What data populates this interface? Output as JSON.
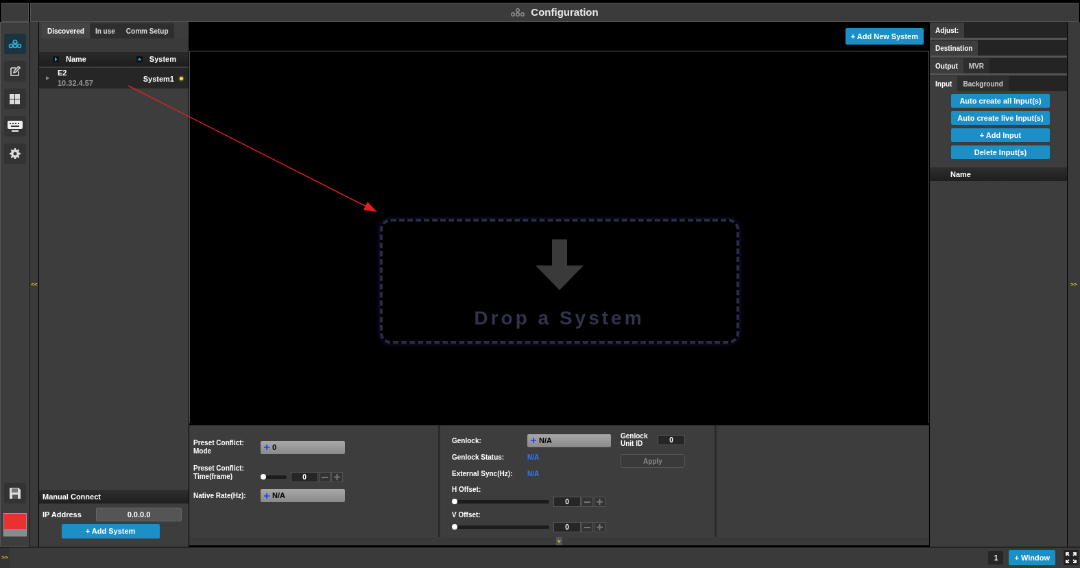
{
  "title_bar": {
    "title": "Configuration"
  },
  "nav_rail": {
    "items": [
      {
        "kind": "network",
        "selected": true
      },
      {
        "kind": "edit",
        "selected": false
      },
      {
        "kind": "grid",
        "selected": false
      },
      {
        "kind": "keyboard",
        "selected": false
      },
      {
        "kind": "settings",
        "selected": false
      }
    ],
    "save": true
  },
  "left_collapse": "<<",
  "left_panel": {
    "tabs": [
      {
        "label": "Discovered",
        "selected": true
      },
      {
        "label": "In use",
        "selected": false
      },
      {
        "label": "Comm Setup",
        "selected": false
      }
    ],
    "columns": [
      "Name",
      "System"
    ],
    "systems": [
      {
        "name": "E2",
        "address": "10.32.4.57",
        "system": "System1",
        "expanded": false,
        "color": "#e8e04a"
      }
    ],
    "manual_connect": {
      "title": "Manual Connect",
      "ip_label": "IP Address",
      "ip_value": "0.0.0.0",
      "button": "+ Add System"
    }
  },
  "canvas": {
    "add_button": "+ Add New System",
    "drop_text": "Drop a System"
  },
  "settings": {
    "left": [
      {
        "kind": "dropdown",
        "label": "Preset Conflict: Mode",
        "value": "0"
      },
      {
        "kind": "slider",
        "label": "Preset Conflict: Time(frame)",
        "value": "0",
        "level": 0
      },
      {
        "kind": "dropdown",
        "label": "Native Rate(Hz):",
        "value": "N/A"
      }
    ],
    "middle": [
      {
        "kind": "dropdown",
        "label": "Genlock:",
        "value": "N/A"
      },
      {
        "kind": "status",
        "label": "Genlock Status:",
        "value": "N/A"
      },
      {
        "kind": "status",
        "label": "External Sync(Hz):",
        "value": "N/A"
      },
      {
        "kind": "slider",
        "label": "H Offset:",
        "value": "0",
        "level": 0
      },
      {
        "kind": "slider",
        "label": "V Offset:",
        "value": "0",
        "level": 0
      }
    ],
    "unit_id": {
      "label": "Genlock Unit ID",
      "value": "0"
    },
    "apply": {
      "label": "Apply",
      "disabled": true
    }
  },
  "splitter": "v",
  "right_collapse": ">>",
  "right_panel": {
    "tab_rows": [
      {
        "tabs": [
          {
            "label": "Adjust:",
            "selected": true
          }
        ]
      },
      {
        "tabs": [
          {
            "label": "Destination",
            "selected": true
          }
        ]
      },
      {
        "tabs": [
          {
            "label": "Output",
            "selected": true
          },
          {
            "label": "MVR",
            "selected": false
          }
        ]
      },
      {
        "tabs": [
          {
            "label": "Input",
            "selected": true
          },
          {
            "label": "Background",
            "selected": false
          }
        ]
      }
    ],
    "buttons": [
      "Auto create all Input(s)",
      "Auto create live Input(s)",
      "+ Add Input",
      "Delete Input(s)"
    ],
    "columns": [
      "Name"
    ]
  },
  "bottom_bar": {
    "toggle": ">>",
    "page": "1",
    "window_button": "+ Window"
  }
}
